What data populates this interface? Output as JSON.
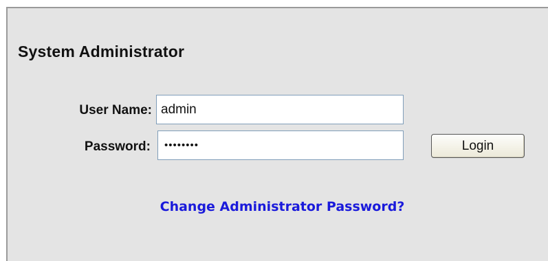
{
  "form": {
    "title": "System Administrator",
    "username_label": "User Name:",
    "username_value": "admin",
    "password_label": "Password:",
    "password_value": "••••••••",
    "login_label": "Login",
    "change_password_link": "Change Administrator Password?"
  },
  "colors": {
    "panel_background": "#e4e4e4",
    "link": "#1a1adb"
  }
}
